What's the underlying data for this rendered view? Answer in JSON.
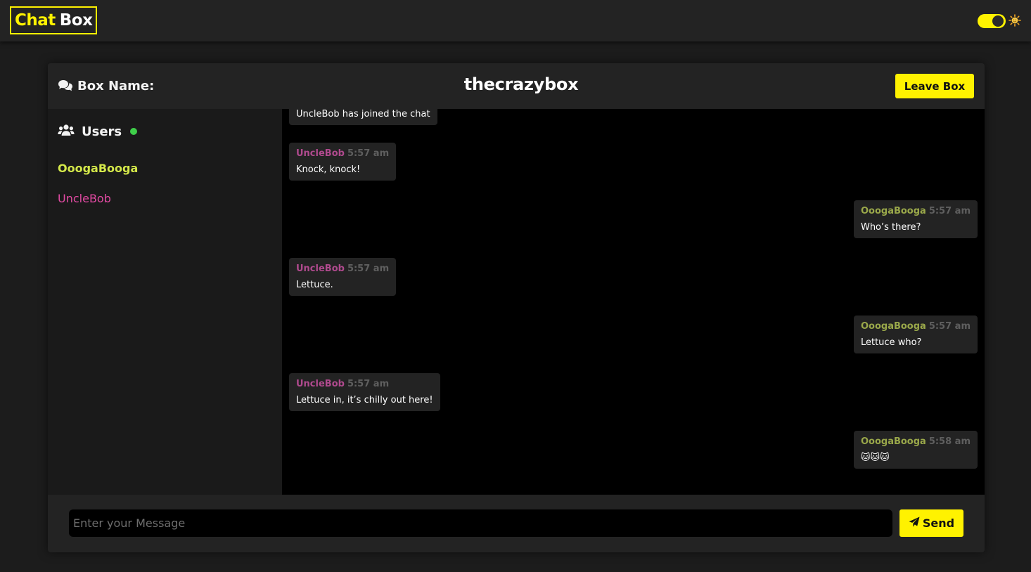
{
  "app": {
    "logo_part1": "Chat",
    "logo_part2": "Box",
    "theme_icon": "sun-icon"
  },
  "header": {
    "box_name_label": "Box Name:",
    "room_name": "thecrazybox",
    "leave_label": "Leave Box"
  },
  "sidebar": {
    "users_heading": "Users",
    "users": [
      {
        "name": "OoogaBooga",
        "color": "#d4e84a"
      },
      {
        "name": "UncleBob",
        "color": "#e24aa3"
      }
    ]
  },
  "messages": [
    {
      "type": "system",
      "text": "UncleBob has joined the chat"
    },
    {
      "type": "incoming",
      "author": "UncleBob",
      "time": "5:57 am",
      "text": "Knock, knock!"
    },
    {
      "type": "outgoing",
      "author": "OoogaBooga",
      "time": "5:57 am",
      "text": "Who’s there?"
    },
    {
      "type": "incoming",
      "author": "UncleBob",
      "time": "5:57 am",
      "text": "Lettuce."
    },
    {
      "type": "outgoing",
      "author": "OoogaBooga",
      "time": "5:57 am",
      "text": "Lettuce who?"
    },
    {
      "type": "incoming",
      "author": "UncleBob",
      "time": "5:57 am",
      "text": "Lettuce in, it’s chilly out here!"
    },
    {
      "type": "outgoing",
      "author": "OoogaBooga",
      "time": "5:58 am",
      "text": "🐱🐱🐱"
    }
  ],
  "composer": {
    "placeholder": "Enter your Message",
    "value": "",
    "send_label": "Send"
  },
  "colors": {
    "accent": "#fff200",
    "online": "#3fcf4a",
    "bob": "#b04a8e",
    "ooga": "#9aa84a"
  }
}
